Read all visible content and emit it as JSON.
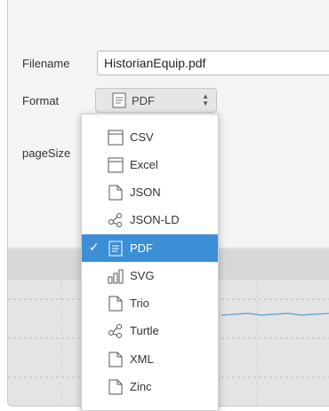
{
  "dialog": {
    "filename_label": "Filename",
    "filename_value": "HistorianEquip.pdf",
    "format_label": "Format",
    "format_selected": "PDF",
    "pagesize_label": "pageSize"
  },
  "format_menu": {
    "items": [
      {
        "label": "CSV",
        "icon": "document-icon"
      },
      {
        "label": "Excel",
        "icon": "document-icon"
      },
      {
        "label": "JSON",
        "icon": "file-icon"
      },
      {
        "label": "JSON-LD",
        "icon": "graph-icon"
      },
      {
        "label": "PDF",
        "icon": "pdf-icon",
        "selected": true
      },
      {
        "label": "SVG",
        "icon": "bar-chart-icon"
      },
      {
        "label": "Trio",
        "icon": "file-icon"
      },
      {
        "label": "Turtle",
        "icon": "graph-icon"
      },
      {
        "label": "XML",
        "icon": "file-icon"
      },
      {
        "label": "Zinc",
        "icon": "file-icon"
      }
    ]
  },
  "colors": {
    "selection": "#3b8fd6",
    "chart_line": "#5a9fd4"
  }
}
